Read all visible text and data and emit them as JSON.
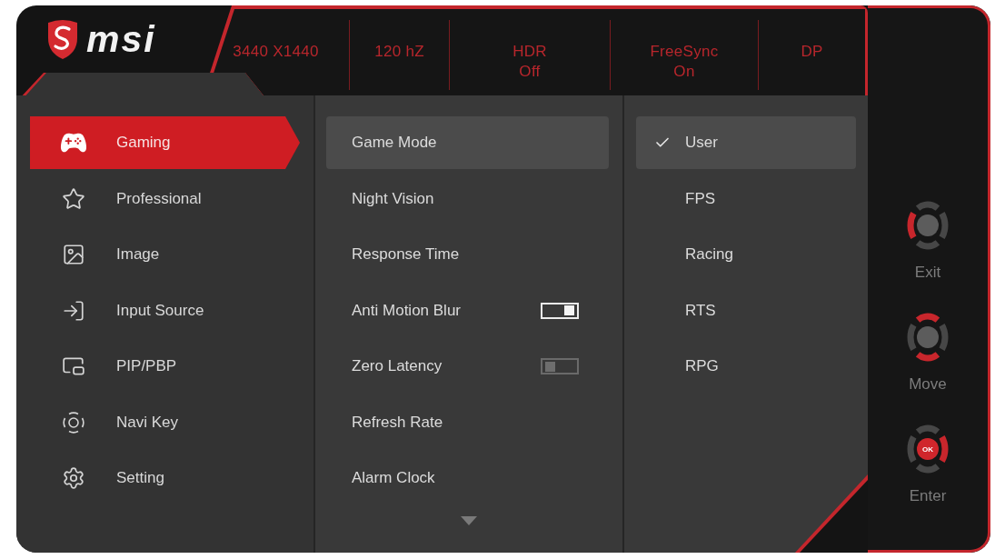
{
  "brand": "msi",
  "status": [
    {
      "label": "3440 X1440"
    },
    {
      "label": "120 hZ"
    },
    {
      "label": "HDR",
      "value": "Off"
    },
    {
      "label": "FreeSync",
      "value": "On"
    },
    {
      "label": "DP"
    }
  ],
  "menu": [
    {
      "label": "Gaming",
      "selected": true
    },
    {
      "label": "Professional",
      "selected": false
    },
    {
      "label": "Image",
      "selected": false
    },
    {
      "label": "Input Source",
      "selected": false
    },
    {
      "label": "PIP/PBP",
      "selected": false
    },
    {
      "label": "Navi Key",
      "selected": false
    },
    {
      "label": "Setting",
      "selected": false
    }
  ],
  "submenu": [
    {
      "kind": "item",
      "label": "Game Mode",
      "selected": true
    },
    {
      "kind": "item",
      "label": "Night Vision",
      "selected": false
    },
    {
      "kind": "item",
      "label": "Response Time",
      "selected": false
    },
    {
      "kind": "toggle",
      "label": "Anti Motion Blur",
      "selected": false,
      "on": true
    },
    {
      "kind": "toggle",
      "label": "Zero Latency",
      "selected": false,
      "on": false
    },
    {
      "kind": "item",
      "label": "Refresh Rate",
      "selected": false
    },
    {
      "kind": "item",
      "label": "Alarm Clock",
      "selected": false
    }
  ],
  "options": [
    {
      "label": "User",
      "selected": true
    },
    {
      "label": "FPS",
      "selected": false
    },
    {
      "label": "Racing",
      "selected": false
    },
    {
      "label": "RTS",
      "selected": false
    },
    {
      "label": "RPG",
      "selected": false
    }
  ],
  "nav_hints": [
    {
      "label": "Exit",
      "lit": {
        "up": false,
        "right": false,
        "down": false,
        "left": true,
        "center": false
      }
    },
    {
      "label": "Move",
      "lit": {
        "up": true,
        "right": false,
        "down": true,
        "left": false,
        "center": false
      }
    },
    {
      "label": "Enter",
      "lit": {
        "up": false,
        "right": true,
        "down": false,
        "left": false,
        "center": true
      },
      "center_label": "OK"
    }
  ]
}
